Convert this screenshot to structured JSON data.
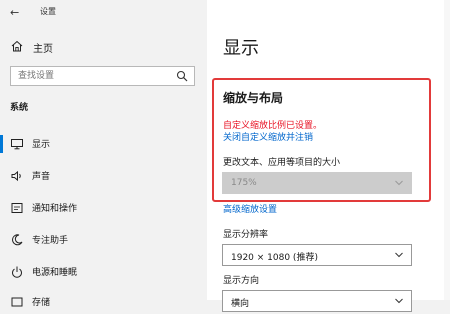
{
  "app": {
    "title": "设置"
  },
  "sidebar": {
    "home_label": "主页",
    "search_placeholder": "查找设置",
    "section_header": "系统",
    "items": [
      {
        "label": "显示",
        "icon": "monitor-icon",
        "active": true
      },
      {
        "label": "声音",
        "icon": "speaker-icon",
        "active": false
      },
      {
        "label": "通知和操作",
        "icon": "notification-icon",
        "active": false
      },
      {
        "label": "专注助手",
        "icon": "moon-icon",
        "active": false
      },
      {
        "label": "电源和睡眠",
        "icon": "power-icon",
        "active": false
      },
      {
        "label": "存储",
        "icon": "storage-icon",
        "active": false
      }
    ]
  },
  "main": {
    "title": "显示",
    "scale_section": {
      "title": "缩放与布局",
      "warning": "自定义缩放比例已设置。",
      "turn_off_link": "关闭自定义缩放并注销",
      "scale_label": "更改文本、应用等项目的大小",
      "scale_value": "175%",
      "advanced_link": "高级缩放设置"
    },
    "resolution": {
      "label": "显示分辨率",
      "value": "1920 × 1080 (推荐)"
    },
    "orientation": {
      "label": "显示方向",
      "value": "横向"
    }
  },
  "colors": {
    "accent": "#0078d7",
    "highlight_border": "#e23a3a",
    "warning": "#e81123",
    "link": "#0066cc"
  }
}
